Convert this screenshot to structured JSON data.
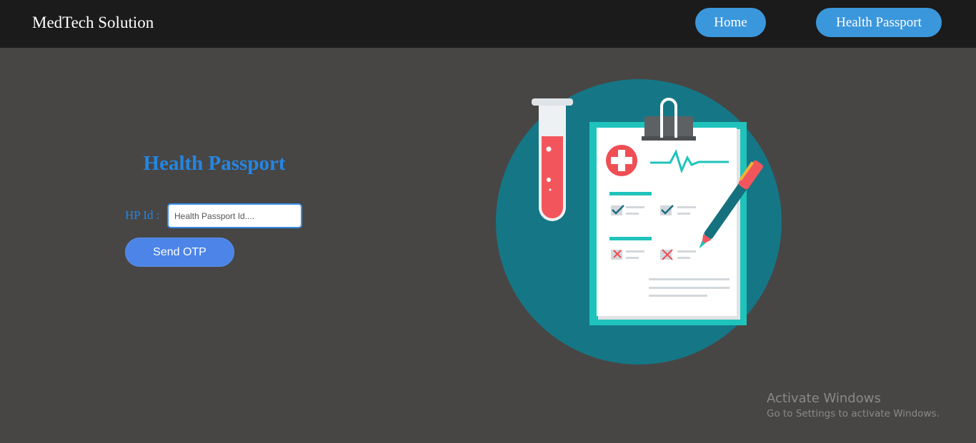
{
  "navbar": {
    "brand": "MedTech Solution",
    "links": [
      {
        "label": "Home"
      },
      {
        "label": "Health Passport"
      }
    ]
  },
  "form": {
    "title": "Health Passport",
    "field_label": "HP Id :",
    "input_placeholder": "Health Passport Id....",
    "input_value": "",
    "submit_label": "Send OTP"
  },
  "watermark": {
    "title": "Activate Windows",
    "subtitle": "Go to Settings to activate Windows."
  },
  "colors": {
    "navbar_bg": "#1b1b1b",
    "page_bg": "#474645",
    "nav_button": "#3b97dc",
    "accent_text": "#2486e4",
    "submit_button": "#4c84e8",
    "circle": "#157786"
  },
  "illustration": {
    "icons": [
      "test-tube-icon",
      "clipboard-icon",
      "medical-cross-icon",
      "heartbeat-icon",
      "checkmark-icon",
      "cross-mark-icon",
      "pen-icon"
    ]
  }
}
